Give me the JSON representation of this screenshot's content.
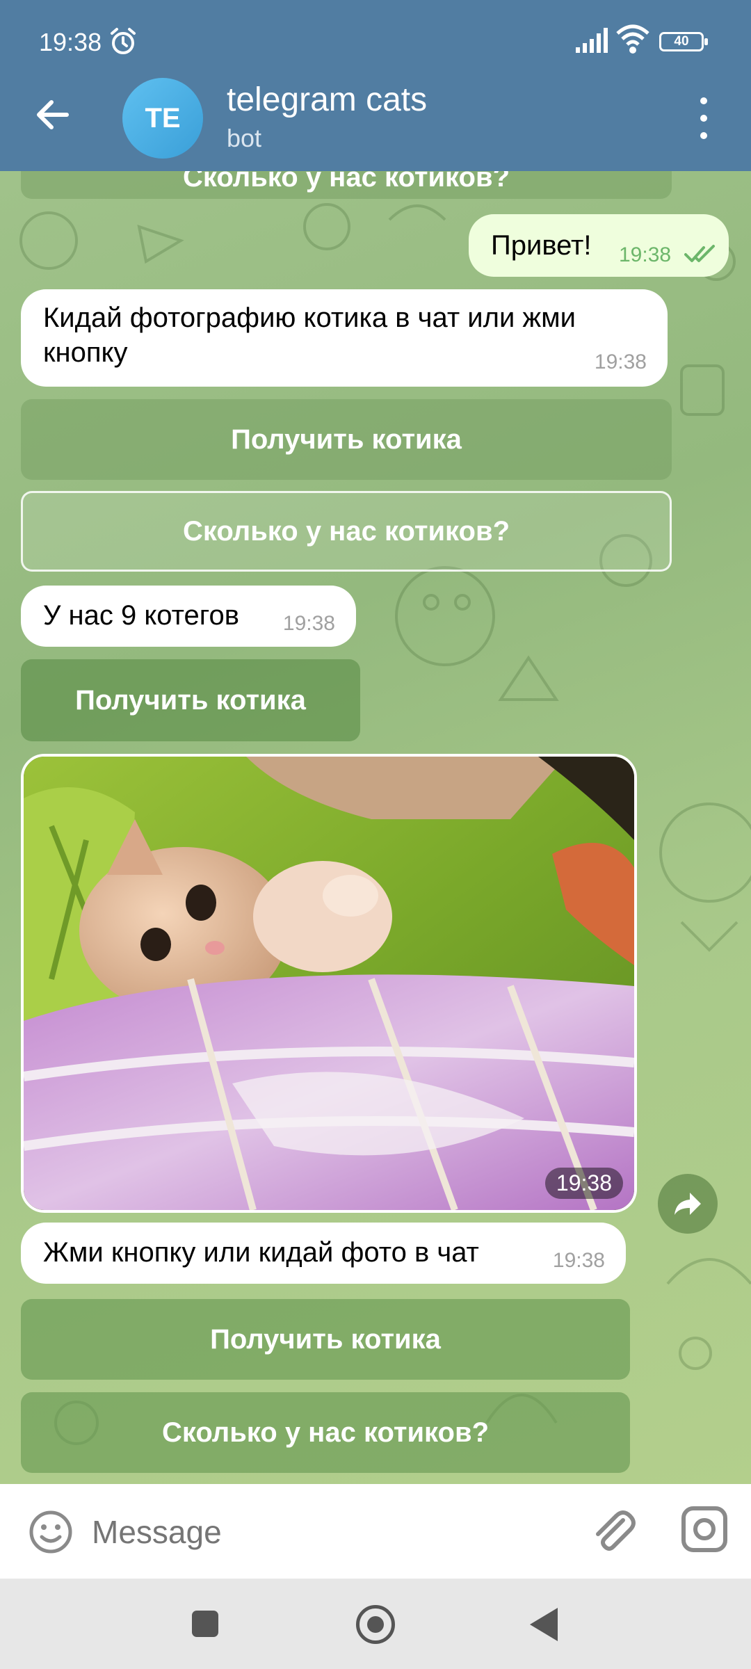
{
  "status": {
    "time": "19:38",
    "battery": "40"
  },
  "header": {
    "avatar_initials": "TE",
    "title": "telegram cats",
    "subtitle": "bot"
  },
  "messages": {
    "top_button_partial": "Сколько у нас котиков?",
    "out_1": {
      "text": "Привет!",
      "time": "19:38"
    },
    "in_1": {
      "text_line1": "Кидай фотографию котика в чат или жми",
      "text_line2": "кнопку",
      "time": "19:38"
    },
    "kbd_1": {
      "get_cat": "Получить котика",
      "count_cats": "Сколько у нас котиков?"
    },
    "in_2": {
      "text": "У нас 9 котегов",
      "time": "19:38"
    },
    "kbd_2": {
      "get_cat": "Получить котика"
    },
    "photo": {
      "time": "19:38"
    },
    "in_3": {
      "text": "Жми кнопку или кидай фото в чат",
      "time": "19:38"
    },
    "kbd_3": {
      "get_cat": "Получить котика",
      "count_cats": "Сколько у нас котиков?"
    }
  },
  "input": {
    "placeholder": "Message"
  },
  "colors": {
    "header": "#517da2",
    "outgoing_bubble": "#effedd",
    "check": "#6cb66a"
  },
  "icons": [
    "alarm-icon",
    "signal-icon",
    "wifi-icon",
    "back-arrow-icon",
    "more-vertical-icon",
    "double-check-icon",
    "forward-icon",
    "emoji-icon",
    "attach-icon",
    "camera-icon"
  ]
}
